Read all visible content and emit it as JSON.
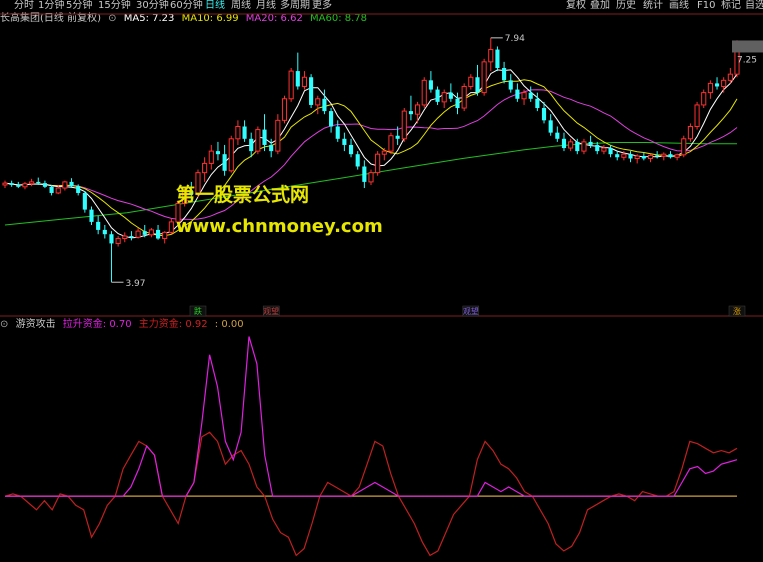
{
  "toolbar": {
    "left_items": [
      "分时",
      "1分钟",
      "5分钟",
      "15分钟",
      "30分钟",
      "60分钟",
      "日线",
      "周线",
      "月线",
      "多周期",
      "更多"
    ],
    "active": "日线",
    "right_items": [
      "复权",
      "叠加",
      "历史",
      "统计",
      "画线",
      "F10",
      "标记",
      "自选"
    ]
  },
  "main_panel": {
    "stock_title": "长高集团(日线 前复权)",
    "ma5_label": "MA5: 7.23",
    "ma10_label": "MA10: 6.99",
    "ma20_label": "MA20: 6.62",
    "ma60_label": "MA60: 8.78",
    "max_price_label": "7.94",
    "min_price_label": "3.97",
    "last_price_label": "7.25",
    "colors": {
      "ma5": "#ffffff",
      "ma10": "#e6e600",
      "ma20": "#e040e0",
      "ma60": "#20c020",
      "up": "#ff3030",
      "down": "#30ffff"
    }
  },
  "watermark": {
    "line1": "第一股票公式网",
    "line2": "www.chnmoney.com"
  },
  "signals": [
    {
      "label": "跌",
      "color": "#20d020"
    },
    {
      "label": "观望",
      "color": "#c04040"
    },
    {
      "label": "观望",
      "color": "#8060e0"
    },
    {
      "label": "涨",
      "color": "#e0a000"
    }
  ],
  "indicator_panel": {
    "name": "游资攻击",
    "line1_label": "拉升资金: 0.70",
    "line2_label": "主力资金: 0.92",
    "line3_label": ": 0.00",
    "colors": {
      "line1": "#e020e0",
      "line2": "#c02020",
      "zero": "#d0a040"
    }
  },
  "chart_data": {
    "type": "candlestick",
    "y_range": [
      3.6,
      8.1
    ],
    "candles": [
      [
        5.55,
        5.62,
        5.5,
        5.58
      ],
      [
        5.58,
        5.62,
        5.52,
        5.55
      ],
      [
        5.55,
        5.6,
        5.5,
        5.52
      ],
      [
        5.52,
        5.6,
        5.48,
        5.57
      ],
      [
        5.57,
        5.65,
        5.53,
        5.6
      ],
      [
        5.6,
        5.67,
        5.55,
        5.58
      ],
      [
        5.58,
        5.62,
        5.5,
        5.52
      ],
      [
        5.52,
        5.55,
        5.38,
        5.42
      ],
      [
        5.42,
        5.55,
        5.4,
        5.5
      ],
      [
        5.5,
        5.62,
        5.46,
        5.6
      ],
      [
        5.6,
        5.66,
        5.5,
        5.53
      ],
      [
        5.53,
        5.56,
        5.38,
        5.42
      ],
      [
        5.42,
        5.45,
        5.1,
        5.15
      ],
      [
        5.15,
        5.2,
        4.9,
        4.95
      ],
      [
        4.95,
        5.05,
        4.75,
        4.82
      ],
      [
        4.82,
        4.9,
        4.68,
        4.75
      ],
      [
        4.75,
        4.8,
        3.97,
        4.6
      ],
      [
        4.6,
        4.72,
        4.55,
        4.68
      ],
      [
        4.68,
        4.78,
        4.62,
        4.72
      ],
      [
        4.72,
        4.8,
        4.65,
        4.7
      ],
      [
        4.7,
        4.85,
        4.68,
        4.8
      ],
      [
        4.8,
        4.9,
        4.7,
        4.74
      ],
      [
        4.74,
        4.85,
        4.7,
        4.82
      ],
      [
        4.82,
        4.9,
        4.66,
        4.68
      ],
      [
        4.68,
        4.8,
        4.6,
        4.78
      ],
      [
        4.78,
        5.0,
        4.75,
        4.95
      ],
      [
        4.95,
        5.3,
        4.9,
        5.25
      ],
      [
        5.25,
        5.5,
        5.2,
        5.45
      ],
      [
        5.45,
        5.6,
        5.3,
        5.4
      ],
      [
        5.4,
        5.8,
        5.35,
        5.75
      ],
      [
        5.75,
        6.0,
        5.6,
        5.9
      ],
      [
        5.9,
        6.2,
        5.8,
        6.1
      ],
      [
        6.1,
        6.25,
        5.95,
        6.05
      ],
      [
        6.05,
        6.2,
        5.7,
        5.78
      ],
      [
        5.78,
        6.35,
        5.75,
        6.3
      ],
      [
        6.3,
        6.6,
        6.2,
        6.5
      ],
      [
        6.5,
        6.6,
        6.25,
        6.3
      ],
      [
        6.3,
        6.4,
        6.0,
        6.1
      ],
      [
        6.1,
        6.5,
        6.05,
        6.45
      ],
      [
        6.45,
        6.7,
        6.1,
        6.2
      ],
      [
        6.2,
        6.3,
        6.0,
        6.1
      ],
      [
        6.1,
        6.7,
        6.05,
        6.6
      ],
      [
        6.6,
        7.0,
        6.55,
        6.95
      ],
      [
        6.95,
        7.45,
        6.9,
        7.4
      ],
      [
        7.4,
        7.7,
        7.1,
        7.15
      ],
      [
        7.15,
        7.4,
        7.1,
        7.3
      ],
      [
        7.3,
        7.35,
        6.8,
        6.85
      ],
      [
        6.85,
        7.0,
        6.7,
        6.95
      ],
      [
        6.95,
        7.1,
        6.7,
        6.75
      ],
      [
        6.75,
        6.8,
        6.4,
        6.5
      ],
      [
        6.5,
        6.6,
        6.25,
        6.3
      ],
      [
        6.3,
        6.4,
        6.1,
        6.2
      ],
      [
        6.2,
        6.3,
        6.0,
        6.05
      ],
      [
        6.05,
        6.1,
        5.8,
        5.85
      ],
      [
        5.85,
        5.95,
        5.5,
        5.6
      ],
      [
        5.6,
        5.8,
        5.55,
        5.75
      ],
      [
        5.75,
        6.1,
        5.7,
        6.05
      ],
      [
        6.05,
        6.15,
        5.95,
        6.1
      ],
      [
        6.1,
        6.4,
        6.05,
        6.35
      ],
      [
        6.35,
        6.5,
        6.2,
        6.3
      ],
      [
        6.3,
        6.8,
        6.25,
        6.75
      ],
      [
        6.75,
        7.0,
        6.6,
        6.7
      ],
      [
        6.7,
        6.9,
        6.55,
        6.85
      ],
      [
        6.85,
        7.3,
        6.8,
        7.25
      ],
      [
        7.25,
        7.4,
        7.05,
        7.1
      ],
      [
        7.1,
        7.15,
        6.85,
        6.9
      ],
      [
        6.9,
        7.1,
        6.8,
        7.05
      ],
      [
        7.05,
        7.2,
        6.9,
        6.95
      ],
      [
        6.95,
        7.05,
        6.7,
        6.8
      ],
      [
        6.8,
        7.2,
        6.75,
        7.15
      ],
      [
        7.15,
        7.35,
        7.1,
        7.3
      ],
      [
        7.3,
        7.5,
        7.0,
        7.05
      ],
      [
        7.05,
        7.6,
        7.0,
        7.55
      ],
      [
        7.55,
        7.94,
        7.4,
        7.75
      ],
      [
        7.75,
        7.8,
        7.4,
        7.45
      ],
      [
        7.45,
        7.55,
        7.2,
        7.25
      ],
      [
        7.25,
        7.35,
        7.05,
        7.1
      ],
      [
        7.1,
        7.2,
        6.9,
        6.95
      ],
      [
        6.95,
        7.1,
        6.85,
        7.05
      ],
      [
        7.05,
        7.15,
        6.9,
        6.95
      ],
      [
        6.95,
        7.05,
        6.75,
        6.8
      ],
      [
        6.8,
        6.9,
        6.55,
        6.6
      ],
      [
        6.6,
        6.7,
        6.35,
        6.4
      ],
      [
        6.4,
        6.5,
        6.25,
        6.3
      ],
      [
        6.3,
        6.4,
        6.1,
        6.15
      ],
      [
        6.15,
        6.3,
        6.1,
        6.25
      ],
      [
        6.25,
        6.3,
        6.05,
        6.1
      ],
      [
        6.1,
        6.3,
        6.05,
        6.25
      ],
      [
        6.25,
        6.35,
        6.15,
        6.2
      ],
      [
        6.2,
        6.25,
        6.05,
        6.1
      ],
      [
        6.1,
        6.2,
        6.05,
        6.15
      ],
      [
        6.15,
        6.2,
        6.0,
        6.05
      ],
      [
        6.05,
        6.1,
        5.95,
        6.0
      ],
      [
        6.0,
        6.1,
        5.95,
        6.05
      ],
      [
        6.05,
        6.1,
        5.92,
        5.98
      ],
      [
        5.98,
        6.05,
        5.9,
        6.02
      ],
      [
        6.02,
        6.08,
        5.95,
        5.98
      ],
      [
        5.98,
        6.05,
        5.92,
        6.03
      ],
      [
        6.03,
        6.1,
        5.98,
        6.02
      ],
      [
        6.02,
        6.08,
        5.95,
        6.05
      ],
      [
        6.05,
        6.1,
        5.98,
        6.0
      ],
      [
        6.0,
        6.06,
        5.95,
        6.04
      ],
      [
        6.04,
        6.35,
        6.0,
        6.3
      ],
      [
        6.3,
        6.55,
        6.25,
        6.5
      ],
      [
        6.5,
        6.9,
        6.45,
        6.85
      ],
      [
        6.85,
        7.1,
        6.8,
        7.05
      ],
      [
        7.05,
        7.25,
        6.95,
        7.2
      ],
      [
        7.2,
        7.3,
        7.1,
        7.15
      ],
      [
        7.15,
        7.3,
        7.05,
        7.25
      ],
      [
        7.25,
        7.45,
        7.2,
        7.35
      ],
      [
        7.35,
        7.9,
        7.3,
        7.8
      ]
    ],
    "ma60": [
      4.9,
      4.95,
      5.0,
      5.05,
      5.1,
      5.18,
      5.26,
      5.34,
      5.42,
      5.5,
      5.58,
      5.66,
      5.74,
      5.82,
      5.9,
      5.98,
      6.05,
      6.12,
      6.18,
      6.22,
      6.24,
      6.24,
      6.23,
      6.22,
      6.22
    ],
    "indicator_range": [
      -1.4,
      3.6
    ],
    "line2": [
      0.0,
      0.05,
      0.0,
      -0.15,
      -0.3,
      -0.1,
      -0.3,
      0.05,
      0.0,
      -0.2,
      -0.3,
      -0.9,
      -0.6,
      -0.2,
      0.0,
      0.6,
      0.9,
      1.2,
      1.1,
      0.9,
      0.0,
      -0.3,
      -0.6,
      0.0,
      0.3,
      1.3,
      1.4,
      1.2,
      0.7,
      0.9,
      1.0,
      0.7,
      0.2,
      0.0,
      -0.5,
      -0.8,
      -0.9,
      -1.3,
      -1.15,
      -0.6,
      0.0,
      0.3,
      0.2,
      0.1,
      0.0,
      0.2,
      0.7,
      1.2,
      1.1,
      0.5,
      0.0,
      -0.3,
      -0.6,
      -1.0,
      -1.3,
      -1.2,
      -0.8,
      -0.4,
      -0.2,
      0.0,
      0.8,
      1.2,
      1.0,
      0.7,
      0.6,
      0.4,
      0.1,
      0.0,
      -0.3,
      -0.6,
      -1.05,
      -1.2,
      -1.1,
      -0.8,
      -0.3,
      -0.2,
      -0.1,
      0.0,
      0.05,
      0.0,
      -0.1,
      0.1,
      0.05,
      0.0,
      0.0,
      0.1,
      0.6,
      1.2,
      1.15,
      1.05,
      0.95,
      1.0,
      0.95,
      1.05
    ],
    "line1": [
      0,
      0,
      0,
      0,
      0,
      0,
      0,
      0,
      0,
      0,
      0,
      0,
      0,
      0,
      0,
      0,
      0.2,
      0.6,
      1.1,
      0.9,
      0.0,
      0.0,
      0.0,
      0.0,
      0.3,
      1.6,
      3.1,
      2.4,
      1.2,
      0.8,
      1.4,
      3.5,
      2.9,
      0.9,
      0.0,
      0.0,
      0.0,
      0.0,
      0.0,
      0.0,
      0.0,
      0.0,
      0.0,
      0.0,
      0.0,
      0.1,
      0.2,
      0.3,
      0.2,
      0.1,
      0.0,
      0.0,
      0.0,
      0.0,
      0.0,
      0.0,
      0.0,
      0.0,
      0.0,
      0.0,
      0.0,
      0.3,
      0.2,
      0.1,
      0.2,
      0.1,
      0.0,
      0.0,
      0.0,
      0.0,
      0.0,
      0.0,
      0.0,
      0.0,
      0.0,
      0.0,
      0.0,
      0.0,
      0.0,
      0.0,
      0.0,
      0.0,
      0.0,
      0.0,
      0.0,
      0.0,
      0.3,
      0.6,
      0.65,
      0.5,
      0.55,
      0.7,
      0.75,
      0.8
    ]
  }
}
